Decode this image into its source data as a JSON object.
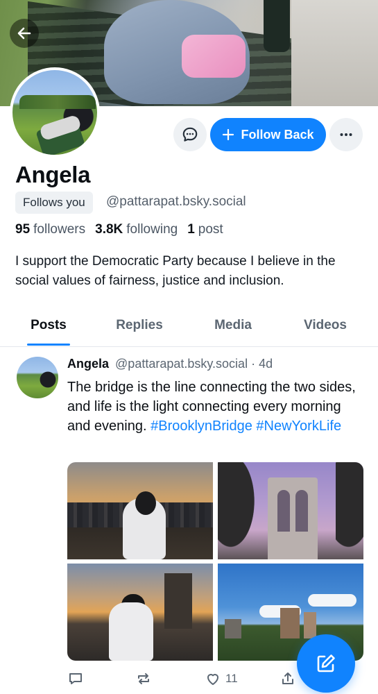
{
  "profile": {
    "name": "Angela",
    "follows_you": "Follows you",
    "handle": "@pattarapat.bsky.social",
    "followers_count": "95",
    "followers_label": "followers",
    "following_count": "3.8K",
    "following_label": "following",
    "posts_count": "1",
    "posts_label": "post",
    "bio": "I support the Democratic Party because I believe in the social values of fairness, justice and inclusion."
  },
  "actions": {
    "follow_label": "Follow Back",
    "message_icon": "chat-bubble-icon",
    "more_icon": "ellipsis-icon",
    "back_icon": "arrow-left-icon"
  },
  "tabs": [
    {
      "label": "Posts",
      "active": true
    },
    {
      "label": "Replies",
      "active": false
    },
    {
      "label": "Media",
      "active": false
    },
    {
      "label": "Videos",
      "active": false
    }
  ],
  "post": {
    "author": "Angela",
    "handle": "@pattarapat.bsky.social",
    "time": "· 4d",
    "text": "The bridge is the line connecting the two sides, and life is the light connecting every morning and evening.",
    "hashtags": [
      "#BrooklynBridge",
      "#NewYorkLife"
    ],
    "likes": "11",
    "images": [
      "sunset-skyline-photo",
      "bridge-tower-dusk-photo",
      "bridge-walkway-photo",
      "park-skyline-photo"
    ]
  },
  "colors": {
    "accent": "#1083fe",
    "muted_text": "#5b6672",
    "chip_bg": "#eef1f4"
  }
}
